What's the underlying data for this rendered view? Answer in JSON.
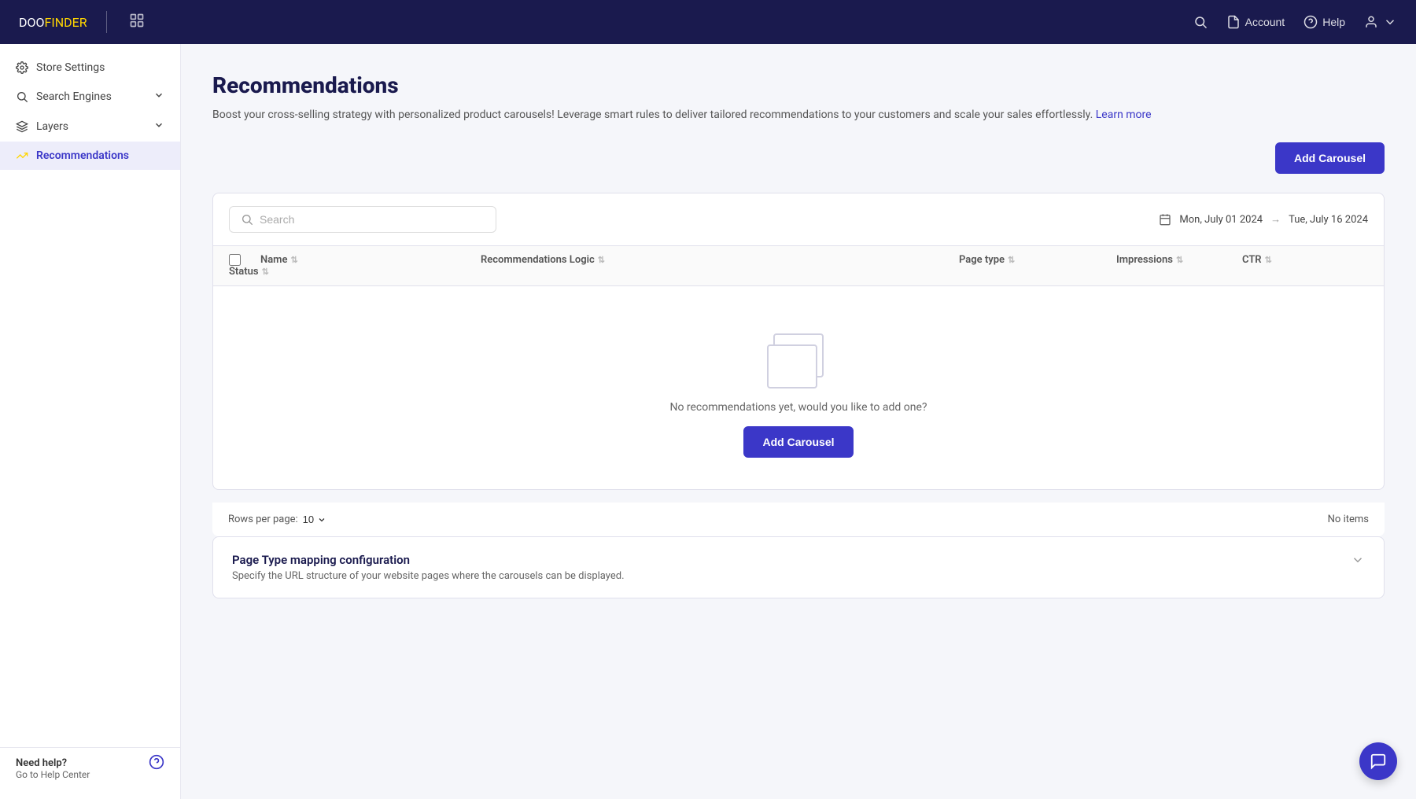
{
  "brand": {
    "doo": "DOO",
    "finder": "FINDER"
  },
  "topnav": {
    "account_label": "Account",
    "help_label": "Help"
  },
  "sidebar": {
    "items": [
      {
        "id": "store-settings",
        "label": "Store Settings",
        "active": false
      },
      {
        "id": "search-engines",
        "label": "Search Engines",
        "active": false,
        "has_chevron": true
      },
      {
        "id": "layers",
        "label": "Layers",
        "active": false,
        "has_chevron": true
      },
      {
        "id": "recommendations",
        "label": "Recommendations",
        "active": true
      }
    ],
    "need_help": "Need help?",
    "go_help": "Go to Help Center"
  },
  "page": {
    "title": "Recommendations",
    "description": "Boost your cross-selling strategy with personalized product carousels! Leverage smart rules to deliver tailored recommendations to your customers and scale your sales effortlessly.",
    "learn_more": "Learn more"
  },
  "toolbar": {
    "add_carousel_label": "Add Carousel",
    "search_placeholder": "Search",
    "date_from": "Mon, July 01 2024",
    "date_to": "Tue, July 16 2024"
  },
  "table": {
    "columns": [
      {
        "id": "name",
        "label": "Name"
      },
      {
        "id": "recommendations-logic",
        "label": "Recommendations Logic"
      },
      {
        "id": "page-type",
        "label": "Page type"
      },
      {
        "id": "impressions",
        "label": "Impressions"
      },
      {
        "id": "ctr",
        "label": "CTR"
      },
      {
        "id": "status",
        "label": "Status"
      }
    ],
    "empty_message": "No recommendations yet, would you like to add one?",
    "add_carousel_label": "Add Carousel"
  },
  "pagination": {
    "rows_label": "Rows per page:",
    "rows_value": "10",
    "no_items_label": "No items"
  },
  "mapping": {
    "title": "Page Type mapping configuration",
    "description": "Specify the URL structure of your website pages where the carousels can be displayed."
  },
  "chat": {
    "label": "chat-support"
  }
}
